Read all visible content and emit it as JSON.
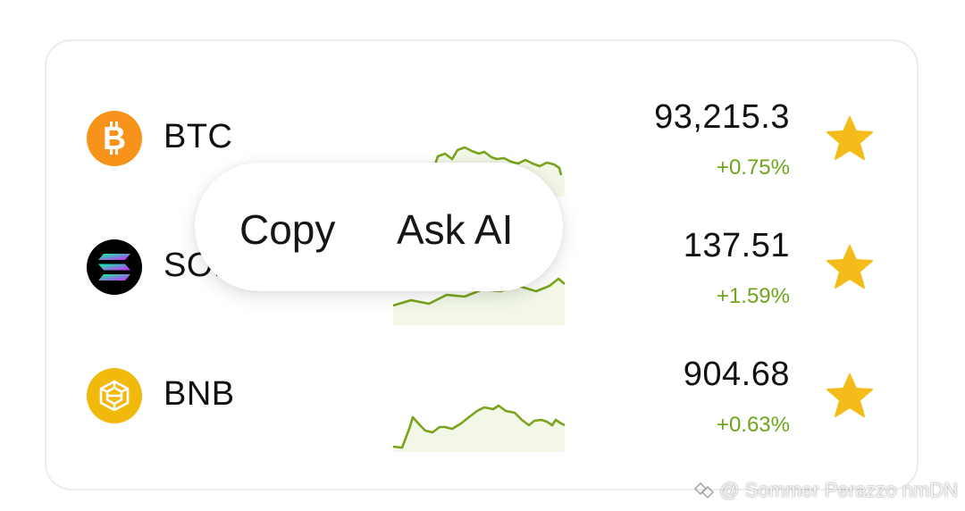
{
  "popup": {
    "copy_label": "Copy",
    "ask_ai_label": "Ask AI"
  },
  "coins": [
    {
      "symbol": "BTC",
      "price": "93,215.3",
      "change": "+0.75%",
      "icon": "bitcoin-icon",
      "favorite": true
    },
    {
      "symbol": "SOL",
      "price": "137.51",
      "change": "+1.59%",
      "icon": "solana-icon",
      "favorite": true
    },
    {
      "symbol": "BNB",
      "price": "904.68",
      "change": "+0.63%",
      "icon": "bnb-icon",
      "favorite": true
    }
  ],
  "colors": {
    "positive": "#6fa51a",
    "star": "#f3bc1a",
    "sparkline": "#7aa419",
    "btc": "#f7931a",
    "bnb": "#f0b90b",
    "sol_bg": "#000000"
  },
  "watermark": {
    "text": "@ Sommer Perazzo nmDN"
  }
}
